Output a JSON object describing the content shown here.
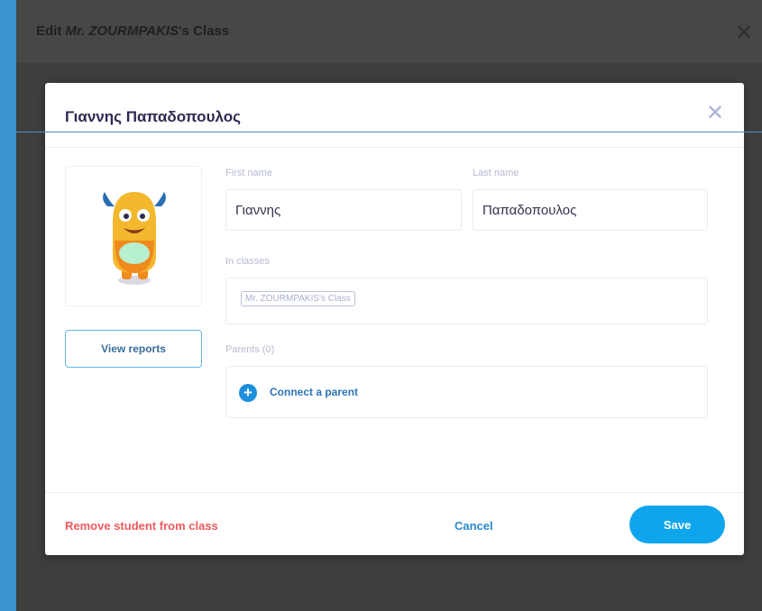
{
  "outer": {
    "title_prefix": "Edit ",
    "title_italic": "Mr. ZOURMPAKIS",
    "title_suffix": "'s Class"
  },
  "modal": {
    "title": "Γιαννης Παπαδοπουλος",
    "close_glyph": "✕",
    "view_reports_label": "View reports",
    "first_name_label": "First name",
    "first_name_value": "Γιαννης",
    "last_name_label": "Last name",
    "last_name_value": "Παπαδοπουλος",
    "in_classes_label": "In classes",
    "class_tag": "Mr. ZOURMPAKIS's Class",
    "parents_label": "Parents (0)",
    "connect_parent_label": "Connect a parent",
    "plus_glyph": "+",
    "remove_label": "Remove student from class",
    "cancel_label": "Cancel",
    "save_label": "Save"
  },
  "colors": {
    "accent": "#0ea5ec",
    "danger": "#f05a5f",
    "link": "#2b89c8"
  },
  "icons": {
    "avatar": "monster-avatar-icon",
    "close": "close-icon",
    "plus": "plus-circle-icon"
  }
}
